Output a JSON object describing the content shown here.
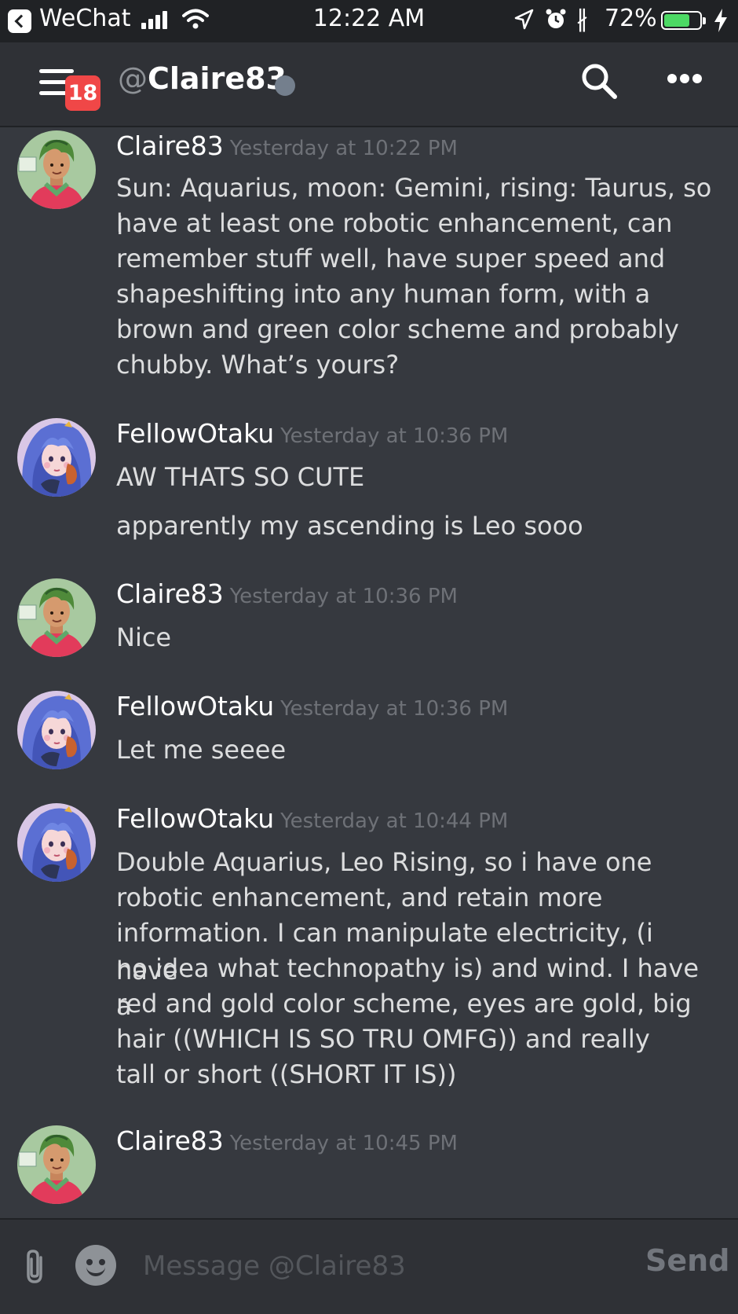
{
  "status_bar": {
    "back_app": "WeChat",
    "time": "12:22 AM",
    "battery_percent": "72%",
    "battery_level": 0.72
  },
  "header": {
    "notification_count": "18",
    "at_symbol": "@",
    "channel_name": "Claire83",
    "presence_color": "#747f8d"
  },
  "colors": {
    "background": "#36393f",
    "header_bg": "#2f3136",
    "badge": "#f04747",
    "battery_fill": "#4cd964"
  },
  "messages": [
    {
      "author": "Claire83",
      "timestamp": "Yesterday at 10:22 PM",
      "avatar": "claire-avatar",
      "lines": [
        "Sun: Aquarius, moon: Gemini, rising: Taurus, so I",
        "have at least one robotic enhancement, can",
        "remember stuff well, have super speed and",
        "shapeshifting into any human form, with a",
        "brown and green color scheme and probably",
        "chubby. What’s yours?"
      ]
    },
    {
      "author": "FellowOtaku",
      "timestamp": "Yesterday at 10:36 PM",
      "avatar": "fellowotaku-avatar",
      "lines": [
        "AW THATS SO CUTE",
        "apparently my ascending is Leo sooo"
      ]
    },
    {
      "author": "Claire83",
      "timestamp": "Yesterday at 10:36 PM",
      "avatar": "claire-avatar",
      "lines": [
        "Nice"
      ]
    },
    {
      "author": "FellowOtaku",
      "timestamp": "Yesterday at 10:36 PM",
      "avatar": "fellowotaku-avatar",
      "lines": [
        "Let me seeee"
      ]
    },
    {
      "author": "FellowOtaku",
      "timestamp": "Yesterday at 10:44 PM",
      "avatar": "fellowotaku-avatar",
      "lines": [
        "Double Aquarius, Leo Rising, so i have one",
        "robotic enhancement, and retain more",
        "information. I can manipulate electricity, (i have",
        "no idea what technopathy is) and wind. I have a",
        "red and gold color scheme, eyes are gold, big",
        "hair ((WHICH IS SO TRU OMFG)) and really",
        "tall or short ((SHORT IT IS))"
      ]
    },
    {
      "author": "Claire83",
      "timestamp": "Yesterday at 10:45 PM",
      "avatar": "claire-avatar",
      "lines": []
    }
  ],
  "composer": {
    "placeholder": "Message @Claire83",
    "send_label": "Send"
  }
}
